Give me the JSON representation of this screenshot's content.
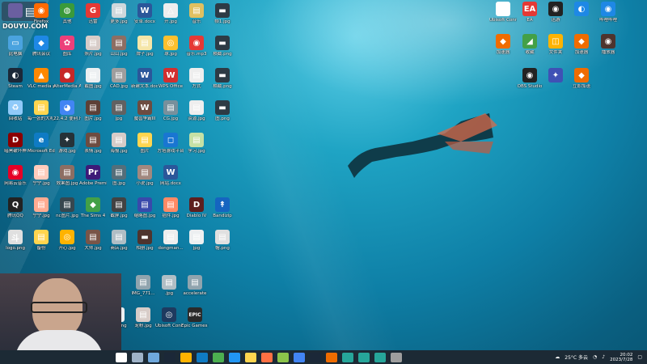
{
  "watermark": {
    "text": "DOUYU.COM"
  },
  "desktop_icons": [
    {
      "label": "",
      "glyph": "",
      "color": "#6a5fa0"
    },
    {
      "label": "Firefox",
      "glyph": "◉",
      "color": "#ff6a00"
    },
    {
      "label": "其他",
      "glyph": "◍",
      "color": "#3a9a3a"
    },
    {
      "label": "迅雷",
      "glyph": "G",
      "color": "#e53935"
    },
    {
      "label": "更多.jpg",
      "glyph": "▤",
      "color": "#cfd8dc"
    },
    {
      "label": "安卓.docx",
      "glyph": "W",
      "color": "#2b579a"
    },
    {
      "label": "开.jpg",
      "glyph": "△",
      "color": "#eeeeee"
    },
    {
      "label": "音乐",
      "glyph": "▤",
      "color": "#e0c060"
    },
    {
      "label": "帧1.jpg",
      "glyph": "▬",
      "color": "#2d3b45"
    },
    {
      "label": "此电脑",
      "glyph": "▭",
      "color": "#4aa3df"
    },
    {
      "label": "腾讯会议",
      "glyph": "◆",
      "color": "#1e88e5"
    },
    {
      "label": "图库",
      "glyph": "✿",
      "color": "#ec407a"
    },
    {
      "label": "照片.jpg",
      "glyph": "▤",
      "color": "#d7ccc8"
    },
    {
      "label": "山山.jpg",
      "glyph": "▤",
      "color": "#8d6e63"
    },
    {
      "label": "牌子.jpg",
      "glyph": "▤",
      "color": "#f5e6a8"
    },
    {
      "label": "球.jpg",
      "glyph": "◎",
      "color": "#fbc02d"
    },
    {
      "label": "音乐.mp3",
      "glyph": "◉",
      "color": "#e53935"
    },
    {
      "label": "横截.png",
      "glyph": "▬",
      "color": "#2d3b45"
    },
    {
      "label": "Steam",
      "glyph": "◐",
      "color": "#1b2838"
    },
    {
      "label": "VLC media player",
      "glyph": "▲",
      "color": "#ff8800"
    },
    {
      "label": "AlterMedia Audio Ca...",
      "glyph": "●",
      "color": "#c62828"
    },
    {
      "label": "截图.jpg",
      "glyph": "▤",
      "color": "#eceff1"
    },
    {
      "label": "CAD.jpg",
      "glyph": "▤",
      "color": "#9e9e9e"
    },
    {
      "label": "新建文本.docx",
      "glyph": "W",
      "color": "#2b579a"
    },
    {
      "label": "WPS Office",
      "glyph": "W",
      "color": "#d32f2f"
    },
    {
      "label": "方式",
      "glyph": "▤",
      "color": "#eeeeee"
    },
    {
      "label": "横截.png",
      "glyph": "▬",
      "color": "#2d3b45"
    },
    {
      "label": "回收站",
      "glyph": "♻",
      "color": "#90caf9"
    },
    {
      "label": "每一张的大礼包",
      "glyph": "▤",
      "color": "#ffd54f"
    },
    {
      "label": "22.4.2 便利.html",
      "glyph": "◕",
      "color": "#4285f4"
    },
    {
      "label": "图片.jpg",
      "glyph": "▤",
      "color": "#5d4037"
    },
    {
      "label": "jpg",
      "glyph": "▤",
      "color": "#616161"
    },
    {
      "label": "魔兽争霸III",
      "glyph": "W",
      "color": "#6d4c41"
    },
    {
      "label": "CG.jpg",
      "glyph": "▤",
      "color": "#78909c"
    },
    {
      "label": "资源.jpg",
      "glyph": "▤",
      "color": "#eeeeee"
    },
    {
      "label": "图.png",
      "glyph": "▬",
      "color": "#2d3b45"
    },
    {
      "label": "暗黑破坏神",
      "glyph": "D",
      "color": "#8b0000"
    },
    {
      "label": "Microsoft Edge",
      "glyph": "e",
      "color": "#0f7bc4"
    },
    {
      "label": "游戏.jpg",
      "glyph": "✦",
      "color": "#263238"
    },
    {
      "label": "表情.jpg",
      "glyph": "▤",
      "color": "#6d4c41"
    },
    {
      "label": "海报.jpg",
      "glyph": "▤",
      "color": "#d7ccc8"
    },
    {
      "label": "图片",
      "glyph": "▤",
      "color": "#ffd54f"
    },
    {
      "label": "方塔游戏平台",
      "glyph": "◻",
      "color": "#1976d2"
    },
    {
      "label": "学习.jpg",
      "glyph": "▤",
      "color": "#c5e1a5"
    },
    {
      "label": "网易云音乐",
      "glyph": "◉",
      "color": "#e60026"
    },
    {
      "label": "宁宁.jpg",
      "glyph": "▤",
      "color": "#ffccbc"
    },
    {
      "label": "效果图.jpg",
      "glyph": "▤",
      "color": "#8d6e63"
    },
    {
      "label": "Adobe Premiere",
      "glyph": "Pr",
      "color": "#3d1a78"
    },
    {
      "label": "图.jpg",
      "glyph": "▤",
      "color": "#546e7a"
    },
    {
      "label": "小说.jpg",
      "glyph": "▤",
      "color": "#a1887f"
    },
    {
      "label": "网站.docx",
      "glyph": "W",
      "color": "#2b579a"
    },
    {
      "label": "腾讯QQ",
      "glyph": "Q",
      "color": "#222222"
    },
    {
      "label": "宁宁.jpg",
      "glyph": "▤",
      "color": "#ffab91"
    },
    {
      "label": "nc图片.jpg",
      "glyph": "▤",
      "color": "#37474f"
    },
    {
      "label": "The Sims 4",
      "glyph": "◆",
      "color": "#43a047"
    },
    {
      "label": "截屏.jpg",
      "glyph": "▤",
      "color": "#424242"
    },
    {
      "label": "缩略图.jpg",
      "glyph": "▤",
      "color": "#3949ab"
    },
    {
      "label": "插件.jpg",
      "glyph": "▤",
      "color": "#ff8a65"
    },
    {
      "label": "Diablo IV",
      "glyph": "D",
      "color": "#5d1f1f"
    },
    {
      "label": "Bandizip",
      "glyph": "↟",
      "color": "#1565c0"
    },
    {
      "label": "logo.png",
      "glyph": "斗",
      "color": "#e0e0e0"
    },
    {
      "label": "备份",
      "glyph": "▤",
      "color": "#ffd54f"
    },
    {
      "label": "开心.jpg",
      "glyph": "◎",
      "color": "#ffb300"
    },
    {
      "label": "大师.jpg",
      "glyph": "▤",
      "color": "#795548"
    },
    {
      "label": "商店.jpg",
      "glyph": "▤",
      "color": "#b0bec5"
    },
    {
      "label": "相册.jpg",
      "glyph": "▬",
      "color": "#4e342e"
    },
    {
      "label": "dongman...",
      "glyph": "▤",
      "color": "#eeeeee"
    },
    {
      "label": "jpg",
      "glyph": "▤",
      "color": "#eceff1"
    },
    {
      "label": "帽.png",
      "glyph": "▤",
      "color": "#e0e0e0"
    },
    {
      "label": "IMG_771...",
      "glyph": "▤",
      "color": "#90a4ae"
    },
    {
      "label": ".jpg",
      "glyph": "▤",
      "color": "#b0bec5"
    },
    {
      "label": "accelerate",
      "glyph": "▤",
      "color": "#90a4ae"
    },
    {
      "label": "关注.png",
      "glyph": "▬",
      "color": "#eceff1"
    },
    {
      "label": "宠粉.jpg",
      "glyph": "▤",
      "color": "#d7ccc8"
    },
    {
      "label": "Ubisoft Connect",
      "glyph": "◎",
      "color": "#1e3a5f"
    },
    {
      "label": "Epic Games Launcher",
      "glyph": "EPIC",
      "color": "#2a2a2a"
    },
    {
      "label": "Ubisoft Connect",
      "glyph": "◎",
      "color": "#ffffff"
    },
    {
      "label": "EA",
      "glyph": "EA",
      "color": "#e53935"
    },
    {
      "label": "迅游",
      "glyph": "◉",
      "color": "#222222"
    },
    {
      "label": "",
      "glyph": "◐",
      "color": "#1e88e5"
    },
    {
      "label": "哔哩哔哩",
      "glyph": "◉",
      "color": "#1e88e5"
    },
    {
      "label": "加速器",
      "glyph": "◆",
      "color": "#ef6c00"
    },
    {
      "label": "收藏",
      "glyph": "◢",
      "color": "#43a047"
    },
    {
      "label": "文件夹",
      "glyph": "◫",
      "color": "#ffb300"
    },
    {
      "label": "加速器",
      "glyph": "◆",
      "color": "#ef6c00"
    },
    {
      "label": "播放器",
      "glyph": "◉",
      "color": "#4e342e"
    },
    {
      "label": "OBS Studio",
      "glyph": "◉",
      "color": "#222222"
    },
    {
      "label": "",
      "glyph": "✦",
      "color": "#3f51b5"
    },
    {
      "label": "立即加速",
      "glyph": "◆",
      "color": "#ef6c00"
    }
  ],
  "taskbar": {
    "apps": [
      "start",
      "search",
      "task-view",
      "steam",
      "explorer",
      "edge",
      "store",
      "mail",
      "folder",
      "game",
      "photos",
      "chrome",
      "steam2",
      "app",
      "app2",
      "app3",
      "app4",
      "app5"
    ],
    "weather": "25°C 多云",
    "time": "20:02",
    "date": "2023/7/28"
  }
}
